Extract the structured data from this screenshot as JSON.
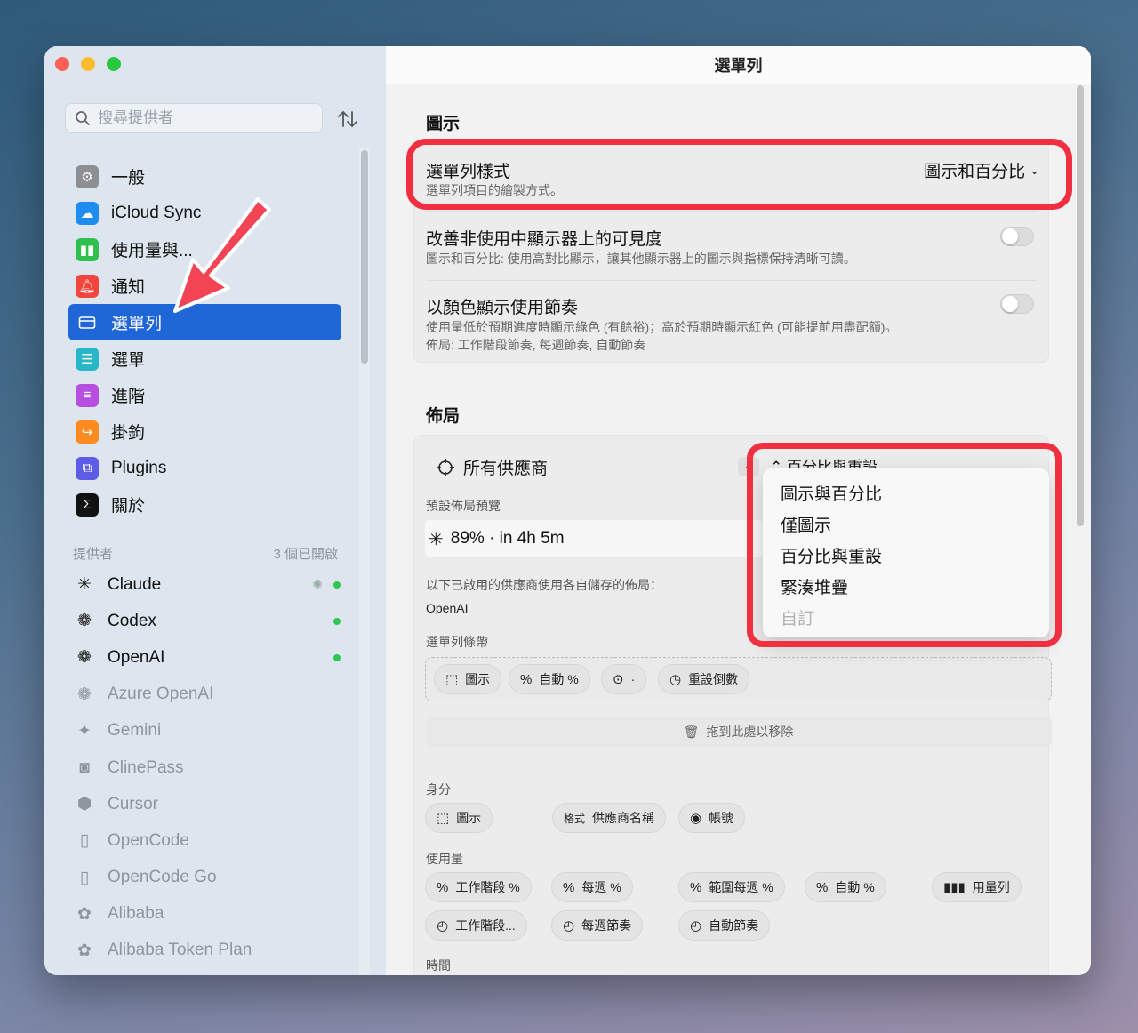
{
  "window": {
    "title": "選單列"
  },
  "sidebar": {
    "search_placeholder": "搜尋提供者",
    "nav": [
      {
        "label": "一般",
        "icon": "gear-icon",
        "color": "#8e8e93"
      },
      {
        "label": "iCloud Sync",
        "icon": "cloud-icon",
        "color": "#1f8cf0"
      },
      {
        "label": "使用量與...",
        "icon": "bar-chart-icon",
        "color": "#30c04e"
      },
      {
        "label": "通知",
        "icon": "bell-icon",
        "color": "#f2453b"
      },
      {
        "label": "選單列",
        "icon": "menubar-icon",
        "color": "#1f66d6"
      },
      {
        "label": "選單",
        "icon": "menu-icon",
        "color": "#27b7c9"
      },
      {
        "label": "進階",
        "icon": "sliders-icon",
        "color": "#b64ee0"
      },
      {
        "label": "掛鉤",
        "icon": "hook-icon",
        "color": "#ff8a1f"
      },
      {
        "label": "Plugins",
        "icon": "plugin-icon",
        "color": "#5e5ce6"
      },
      {
        "label": "關於",
        "icon": "terminal-icon",
        "color": "#111111"
      }
    ],
    "providers_label": "提供者",
    "providers_count": "3 個已開啟",
    "providers": [
      {
        "name": "Claude",
        "icon": "claude-icon",
        "enabled": true,
        "loading": true
      },
      {
        "name": "Codex",
        "icon": "openai-icon",
        "enabled": true
      },
      {
        "name": "OpenAI",
        "icon": "openai-icon",
        "enabled": true
      },
      {
        "name": "Azure OpenAI",
        "icon": "openai-icon",
        "enabled": false
      },
      {
        "name": "Gemini",
        "icon": "sparkle-icon",
        "enabled": false
      },
      {
        "name": "ClinePass",
        "icon": "robot-icon",
        "enabled": false
      },
      {
        "name": "Cursor",
        "icon": "cube-icon",
        "enabled": false
      },
      {
        "name": "OpenCode",
        "icon": "square-icon",
        "enabled": false
      },
      {
        "name": "OpenCode Go",
        "icon": "square-icon",
        "enabled": false
      },
      {
        "name": "Alibaba",
        "icon": "gear-icon",
        "enabled": false
      },
      {
        "name": "Alibaba Token Plan",
        "icon": "gear-icon",
        "enabled": false
      }
    ]
  },
  "main": {
    "icon_section": "圖示",
    "style_row": {
      "title": "選單列樣式",
      "sub": "選單列項目的繪製方式。",
      "value": "圖示和百分比"
    },
    "visibility_row": {
      "title": "改善非使用中顯示器上的可見度",
      "sub": "圖示和百分比: 使用高對比顯示，讓其他顯示器上的圖示與指標保持清晰可讀。"
    },
    "pace_row": {
      "title": "以顏色顯示使用節奏",
      "sub1": "使用量低於預期進度時顯示綠色 (有餘裕)；高於預期時顯示紅色 (可能提前用盡配額)。",
      "sub2": "佈局: 工作階段節奏, 每週節奏, 自動節奏"
    },
    "layout_section": "佈局",
    "all_providers": "所有供應商",
    "layout_select": "百分比與重設",
    "preview_label": "預設佈局預覽",
    "preview_value": "89% · in 4h 5m",
    "saved_note": "以下已啟用的供應商使用各自儲存的佈局：",
    "saved_provider": "OpenAI",
    "strip_label": "選單列條帶",
    "strip_chips": [
      "圖示",
      "自動 %",
      "·",
      "重設倒數"
    ],
    "drop_hint": "拖到此處以移除",
    "identity_label": "身分",
    "identity_chips": [
      "圖示",
      "供應商名稱",
      "帳號"
    ],
    "identity_format": "格式",
    "usage_label": "使用量",
    "usage_chips": [
      "工作階段 %",
      "每週 %",
      "範圍每週 %",
      "自動 %",
      "用量列"
    ],
    "pace_chips": [
      "工作階段...",
      "每週節奏",
      "自動節奏"
    ],
    "time_label": "時間"
  },
  "dropdown": {
    "options": [
      "圖示與百分比",
      "僅圖示",
      "百分比與重設",
      "緊湊堆疊"
    ],
    "disabled_option": "自訂"
  }
}
